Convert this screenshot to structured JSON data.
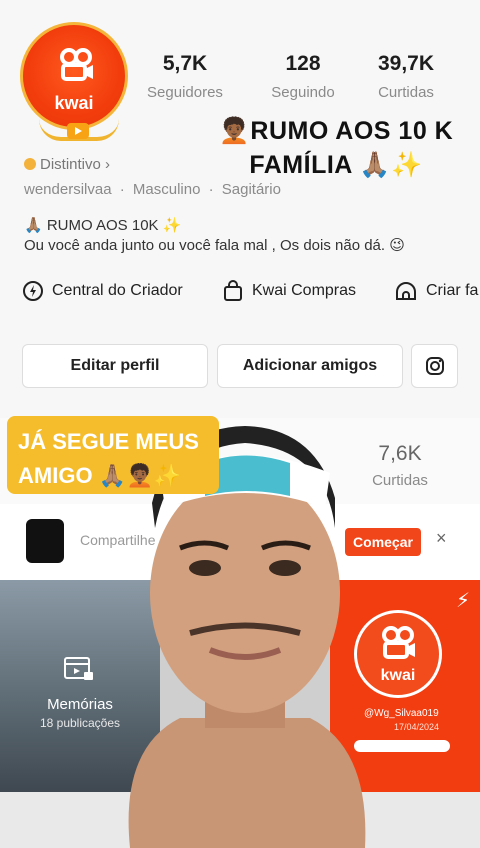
{
  "profile": {
    "avatar_brand": "kwai",
    "stats": [
      {
        "value": "5,7K",
        "label": "Seguidores"
      },
      {
        "value": "128",
        "label": "Seguindo"
      },
      {
        "value": "39,7K",
        "label": "Curtidas"
      }
    ],
    "overlay_title": "🧑🏾‍🦱RUMO AOS 10 K FAMÍLIA 🙏🏽✨",
    "badge_label": "Distintivo",
    "badge_chevron": "›",
    "username": "wendersilvaa",
    "gender": "Masculino",
    "sign": "Sagitário",
    "meta_separator": "·",
    "bio_line1": "🙏🏽 RUMO AOS 10K ✨",
    "bio_line2": "Ou você anda junto ou você fala mal , Os dois não dá. 😉"
  },
  "links": [
    {
      "label": "Central do Criador",
      "icon": "creator-center-icon"
    },
    {
      "label": "Kwai Compras",
      "icon": "shopping-bag-icon"
    },
    {
      "label": "Criar fa",
      "icon": "fan-group-icon"
    }
  ],
  "buttons": {
    "edit_profile": "Editar perfil",
    "add_friends": "Adicionar amigos",
    "instagram_icon": "instagram-icon"
  },
  "content": {
    "likes_value": "7,6K",
    "likes_label": "Curtidas",
    "share_text": "Compartilhe",
    "start_button": "Começar",
    "close": "×",
    "memories_title": "Memórias",
    "memories_count": "18 publicações",
    "kwai_brand": "kwai",
    "kwai_user": "@Wg_Silvaa019",
    "kwai_date": "17/04/2024",
    "lightning": "⚡"
  },
  "sticker": {
    "text": "JÁ SEGUE MEUS AMIGO 🙏🏽🧑🏾‍🦱✨"
  },
  "colors": {
    "kwai_orange": "#f13d10",
    "sticker_yellow": "#f5bd2b",
    "badge_gold": "#f3b23c"
  }
}
